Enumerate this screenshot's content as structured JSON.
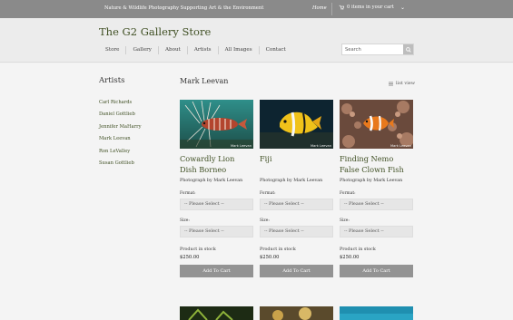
{
  "topbar": {
    "tagline": "Nature & Wildlife Photography Supporting Art & the Environment",
    "home": "Home",
    "cart": "0 items in your cart"
  },
  "header": {
    "site_title": "The G2 Gallery Store",
    "nav": [
      "Store",
      "Gallery",
      "About",
      "Artists",
      "All Images",
      "Contact"
    ],
    "search_placeholder": "Search"
  },
  "sidebar": {
    "heading": "Artists",
    "artists": [
      "Carl Richards",
      "Daniel Gottlieb",
      "Jennifer MaHarry",
      "Mark Leevan",
      "Ron LeValley",
      "Susan Gottlieb"
    ]
  },
  "main": {
    "title": "Mark Leevan",
    "list_view": "list view",
    "products": [
      {
        "title": "Cowardly Lion Dish Borneo",
        "by": "Photograph by Mark Leevan",
        "watermark": "Mark Leevan",
        "format_label": "Format:",
        "format_value": "-- Please Select --",
        "size_label": "Size:",
        "size_value": "-- Please Select --",
        "stock": "Product in stock",
        "price": "$250.00",
        "button": "Add To Cart"
      },
      {
        "title": "Fiji",
        "by": "Photograph by Mark Leevan",
        "watermark": "Mark Leevan",
        "format_label": "Format:",
        "format_value": "-- Please Select --",
        "size_label": "Size:",
        "size_value": "-- Please Select --",
        "stock": "Product in stock",
        "price": "$250.00",
        "button": "Add To Cart"
      },
      {
        "title": "Finding Nemo False Clown Fish",
        "by": "Photograph by Mark Leevan",
        "watermark": "Mark Leevan",
        "format_label": "Format:",
        "format_value": "-- Please Select --",
        "size_label": "Size:",
        "size_value": "-- Please Select --",
        "stock": "Product in stock",
        "price": "$250.00",
        "button": "Add To Cart"
      }
    ]
  },
  "colors": {
    "accent_green": "#3f4f23",
    "topbar": "#8a8a8a",
    "button": "#939393"
  }
}
